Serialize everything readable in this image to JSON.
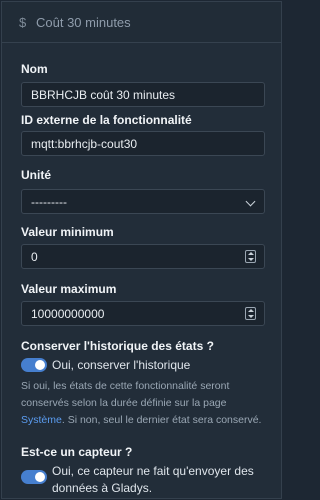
{
  "header": {
    "icon": "dollar-icon",
    "title": "Coût 30 minutes"
  },
  "fields": {
    "name": {
      "label": "Nom",
      "value": "BBRHCJB coût 30 minutes"
    },
    "external_id": {
      "label": "ID externe de la fonctionnalité",
      "value": "mqtt:bbrhcjb-cout30"
    },
    "unit": {
      "label": "Unité",
      "value": "---------"
    },
    "min": {
      "label": "Valeur minimum",
      "value": "0"
    },
    "max": {
      "label": "Valeur maximum",
      "value": "10000000000"
    }
  },
  "history": {
    "label": "Conserver l'historique des états ?",
    "toggle_label": "Oui, conserver l'historique",
    "enabled": true,
    "help_before": "Si oui, les états de cette fonctionnalité seront conservés selon la durée définie sur la page ",
    "help_link": "Système",
    "help_after": ". Si non, seul le dernier état sera conservé."
  },
  "sensor": {
    "label": "Est-ce un capteur ?",
    "toggle_label": "Oui, ce capteur ne fait qu'envoyer des données à Gladys.",
    "enabled": true
  },
  "colors": {
    "accent": "#467fcf",
    "link": "#5b9cf0",
    "background": "#222d39"
  }
}
